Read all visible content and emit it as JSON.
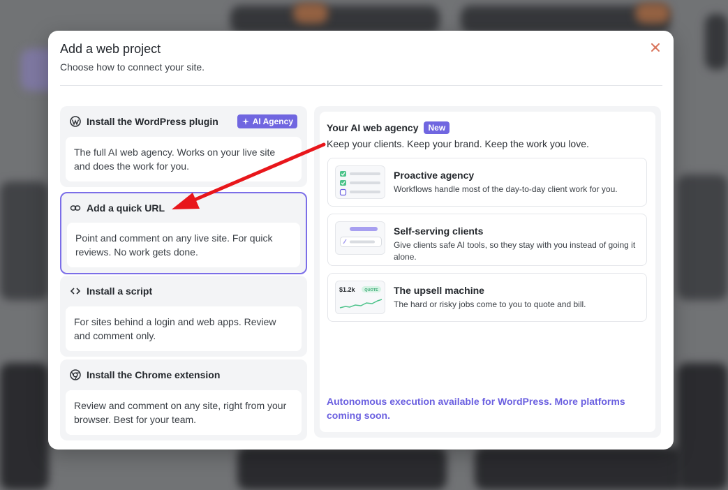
{
  "modal": {
    "title": "Add a web project",
    "subtitle": "Choose how to connect your site."
  },
  "options": [
    {
      "icon": "wordpress-icon",
      "title": "Install the WordPress plugin",
      "badge": "AI Agency",
      "description": "The full AI web agency. Works on your live site and does the work for you."
    },
    {
      "icon": "link-icon",
      "title": "Add a quick URL",
      "description": "Point and comment on any live site. For quick reviews. No work gets done.",
      "selected": true
    },
    {
      "icon": "code-icon",
      "title": "Install a script",
      "description": "For sites behind a login and web apps. Review and comment only."
    },
    {
      "icon": "chrome-icon",
      "title": "Install the Chrome extension",
      "description": "Review and comment on any site, right from your browser. Best for your team."
    }
  ],
  "panel": {
    "title": "Your AI web agency",
    "badge": "New",
    "subtitle": "Keep your clients. Keep your brand. Keep the work you love.",
    "features": [
      {
        "title": "Proactive agency",
        "description": "Workflows handle most of the day-to-day client work for you."
      },
      {
        "title": "Self-serving clients",
        "description": "Give clients safe AI tools, so they stay with you instead of going it alone."
      },
      {
        "title": "The upsell machine",
        "description": "The hard or risky jobs come to you to quote and bill.",
        "thumb_amount": "$1.2k",
        "thumb_tag": "QUOTE"
      }
    ],
    "footer": "Autonomous execution available for WordPress. More platforms coming soon."
  },
  "colors": {
    "accent": "#7066e0",
    "selected_border": "#7b6ee8",
    "annotation_arrow": "#e8161b",
    "close_icon": "#d9735a"
  }
}
